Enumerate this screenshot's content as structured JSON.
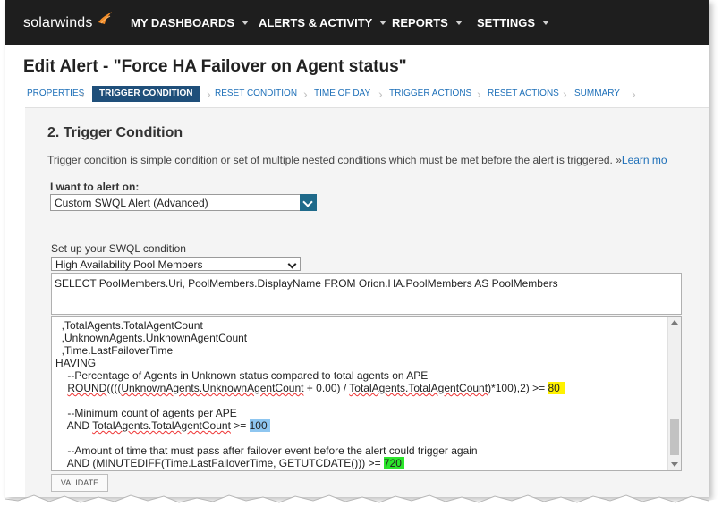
{
  "brand": {
    "name": "solarwinds"
  },
  "nav": [
    {
      "label": "MY DASHBOARDS"
    },
    {
      "label": "ALERTS & ACTIVITY"
    },
    {
      "label": "REPORTS"
    },
    {
      "label": "SETTINGS"
    }
  ],
  "page": {
    "title": "Edit Alert - \"Force HA Failover on Agent status\""
  },
  "steps": [
    {
      "label": "PROPERTIES"
    },
    {
      "label": "TRIGGER CONDITION"
    },
    {
      "label": "RESET CONDITION"
    },
    {
      "label": "TIME OF DAY"
    },
    {
      "label": "TRIGGER ACTIONS"
    },
    {
      "label": "RESET ACTIONS"
    },
    {
      "label": "SUMMARY"
    }
  ],
  "section": {
    "title": "2. Trigger Condition",
    "description": "Trigger condition is simple condition or set of multiple nested conditions which must be met before the alert is triggered. »",
    "learn_more": "Learn mo"
  },
  "alert_on": {
    "label": "I want to alert on:",
    "value": "Custom SWQL Alert (Advanced)"
  },
  "swql": {
    "label": "Set up your SWQL condition",
    "entity": "High Availability Pool Members",
    "select_statement": "SELECT PoolMembers.Uri, PoolMembers.DisplayName FROM Orion.HA.PoolMembers AS PoolMembers",
    "code": {
      "l1": ",TotalAgents.TotalAgentCount",
      "l2": ",UnknownAgents.UnknownAgentCount",
      "l3": ",Time.LastFailoverTime",
      "l4": "HAVING",
      "l5": "--Percentage of Agents in Unknown status compared to total agents on APE",
      "l6a": "ROUND",
      "l6b": "((((",
      "l6c": "UnknownAgents.UnknownAgentCount",
      "l6d": " + 0.00) / ",
      "l6e": "TotalAgents.TotalAgentCount",
      "l6f": ")*100),2) >= ",
      "l6g": "80",
      "l7": "--Minimum count of agents per APE",
      "l8a": "AND ",
      "l8b": "TotalAgents.TotalAgentCount",
      "l8c": " >= ",
      "l8d": "100",
      "l9": "--Amount of time that must pass after failover event before the alert could trigger again",
      "l10a": "AND (MINUTEDIFF(Time.LastFailoverTime, GETUTCDATE())) >= ",
      "l10b": "720"
    }
  },
  "validate_label": "VALIDATE",
  "colors": {
    "topbar": "#1e1e1e",
    "active_step": "#1f4f7a",
    "link": "#1d6fb8",
    "highlight_yellow": "#fff200",
    "highlight_blue": "#8ec6f0",
    "highlight_green": "#2be52b",
    "logo_orange": "#f28c28"
  }
}
